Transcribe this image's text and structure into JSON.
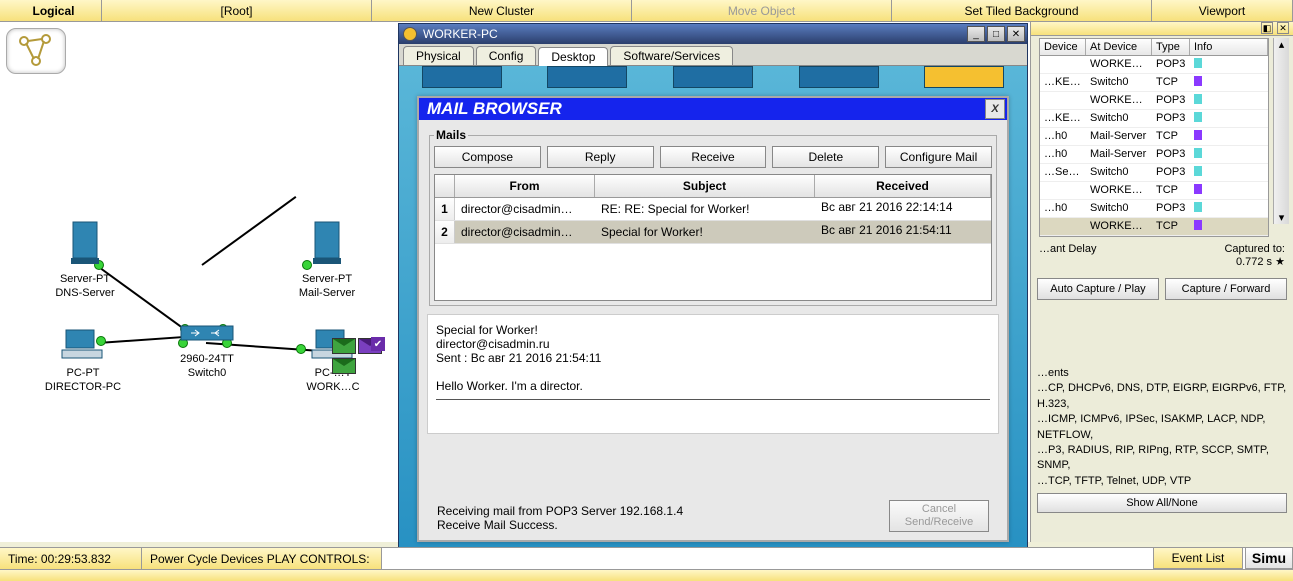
{
  "top_toolbar": {
    "logical": "Logical",
    "root": "[Root]",
    "new_cluster": "New Cluster",
    "move_object": "Move Object",
    "set_tiled": "Set Tiled Background",
    "viewport": "Viewport"
  },
  "devices": {
    "dns": {
      "type": "Server-PT",
      "name": "DNS-Server"
    },
    "mail": {
      "type": "Server-PT",
      "name": "Mail-Server"
    },
    "switch": {
      "type": "2960-24TT",
      "name": "Switch0"
    },
    "director": {
      "type": "PC-PT",
      "name": "DIRECTOR-PC"
    },
    "worker": {
      "type": "PC-PT",
      "name": "WORKER-PC"
    }
  },
  "pc_window": {
    "title": "WORKER-PC",
    "tabs": {
      "physical": "Physical",
      "config": "Config",
      "desktop": "Desktop",
      "software": "Software/Services"
    }
  },
  "mail": {
    "title": "MAIL BROWSER",
    "fieldset": "Mails",
    "buttons": {
      "compose": "Compose",
      "reply": "Reply",
      "receive": "Receive",
      "delete": "Delete",
      "configure": "Configure Mail"
    },
    "columns": {
      "from": "From",
      "subject": "Subject",
      "received": "Received"
    },
    "rows": [
      {
        "n": "1",
        "from": "director@cisadmin…",
        "subject": "RE: RE: Special for Worker!",
        "received": "Вс авг 21 2016 22:14:14"
      },
      {
        "n": "2",
        "from": "director@cisadmin…",
        "subject": "Special for Worker!",
        "received": "Вс авг 21 2016 21:54:11"
      }
    ],
    "body": {
      "subject": "Special for Worker!",
      "from": "director@cisadmin.ru",
      "sent": "Sent : Вс авг 21 2016 21:54:11",
      "text": "Hello Worker. I'm a director."
    },
    "status1": "Receiving mail from POP3 Server 192.168.1.4",
    "status2": "Receive Mail Success.",
    "cancel": "Cancel",
    "sendrecv": "Send/Receive"
  },
  "right": {
    "columns": {
      "device": "Device",
      "at": "At Device",
      "type": "Type",
      "info": "Info"
    },
    "rows": [
      {
        "dev": "",
        "at": "WORKER-…",
        "type": "POP3",
        "color": "#5bd8d8"
      },
      {
        "dev": "…KER-PC",
        "at": "Switch0",
        "type": "TCP",
        "color": "#8b39ff"
      },
      {
        "dev": "",
        "at": "WORKER-…",
        "type": "POP3",
        "color": "#5bd8d8"
      },
      {
        "dev": "…KER-PC",
        "at": "Switch0",
        "type": "POP3",
        "color": "#5bd8d8"
      },
      {
        "dev": "…h0",
        "at": "Mail-Server",
        "type": "TCP",
        "color": "#8b39ff"
      },
      {
        "dev": "…h0",
        "at": "Mail-Server",
        "type": "POP3",
        "color": "#5bd8d8"
      },
      {
        "dev": "…Server",
        "at": "Switch0",
        "type": "POP3",
        "color": "#5bd8d8"
      },
      {
        "dev": "",
        "at": "WORKER-…",
        "type": "TCP",
        "color": "#8b39ff"
      },
      {
        "dev": "…h0",
        "at": "Switch0",
        "type": "POP3",
        "color": "#5bd8d8"
      },
      {
        "dev": "",
        "at": "WORKER-…",
        "type": "TCP",
        "color": "#8b39ff"
      }
    ],
    "delay": "…ant Delay",
    "captured": "Captured to:",
    "captured_val": "0.772 s",
    "auto": "Auto Capture / Play",
    "capfwd": "Capture / Forward",
    "filters_title": "…ents",
    "filters1": "…CP, DHCPv6, DNS, DTP, EIGRP, EIGRPv6, FTP, H.323,",
    "filters2": "…ICMP, ICMPv6, IPSec, ISAKMP, LACP, NDP, NETFLOW,",
    "filters3": "…P3, RADIUS, RIP, RIPng, RTP, SCCP, SMTP, SNMP,",
    "filters4": "…TCP, TFTP, Telnet, UDP, VTP",
    "show_all": "Show All/None"
  },
  "bottom": {
    "time": "Time: 00:29:53.832",
    "power": "Power Cycle Devices PLAY CONTROLS:",
    "event_list": "Event List",
    "simu": "Simu"
  }
}
